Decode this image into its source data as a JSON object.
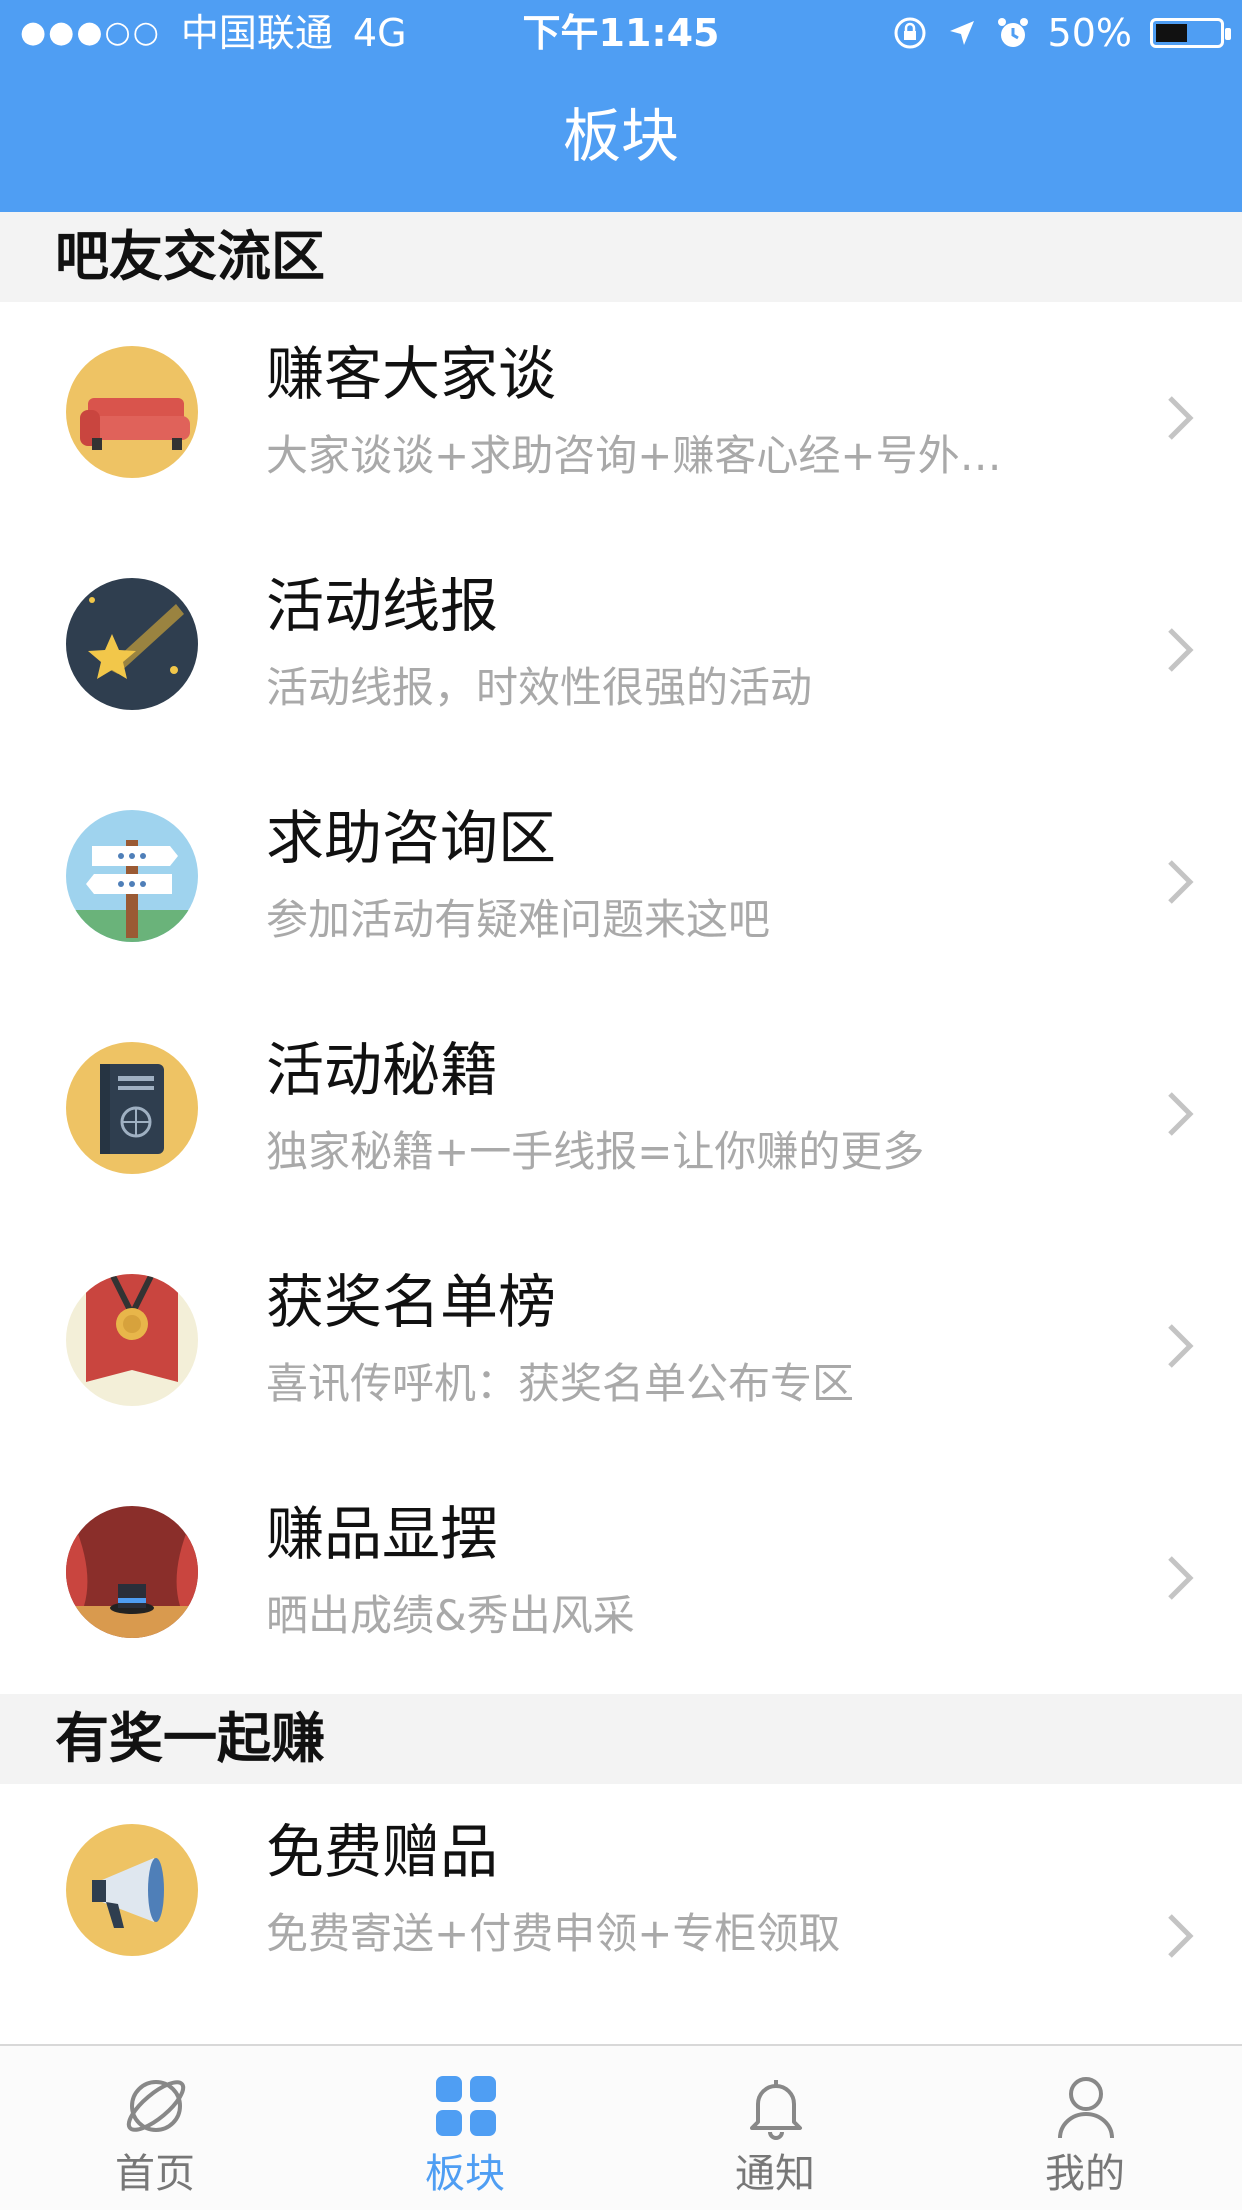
{
  "status_bar": {
    "signal_dots": "●●●○○",
    "carrier": "中国联通",
    "network": "4G",
    "time": "下午11:45",
    "battery_percent": "50%",
    "battery_level": 0.5
  },
  "header": {
    "title": "板块"
  },
  "sections": [
    {
      "title": "吧友交流区",
      "items": [
        {
          "name": "赚客大家谈",
          "desc": "大家谈谈+求助咨询+赚客心经+号外…",
          "icon": "sofa-icon"
        },
        {
          "name": "活动线报",
          "desc": "活动线报，时效性很强的活动",
          "icon": "shooting-star-icon"
        },
        {
          "name": "求助咨询区",
          "desc": "参加活动有疑难问题来这吧",
          "icon": "signpost-icon"
        },
        {
          "name": "活动秘籍",
          "desc": "独家秘籍+一手线报=让你赚的更多",
          "icon": "passport-book-icon"
        },
        {
          "name": "获奖名单榜",
          "desc": "喜讯传呼机：获奖名单公布专区",
          "icon": "medal-icon"
        },
        {
          "name": "赚品显摆",
          "desc": " 晒出成绩&秀出风采",
          "icon": "stage-hat-icon"
        }
      ]
    },
    {
      "title": "有奖一起赚",
      "items": [
        {
          "name": "免费赠品",
          "desc": "免费寄送+付费申领+专柜领取",
          "icon": "megaphone-icon"
        }
      ]
    }
  ],
  "tabbar": {
    "items": [
      {
        "label": "首页",
        "icon": "planet-icon",
        "active": false
      },
      {
        "label": "板块",
        "icon": "grid-icon",
        "active": true
      },
      {
        "label": "通知",
        "icon": "bell-icon",
        "active": false
      },
      {
        "label": "我的",
        "icon": "person-icon",
        "active": false
      }
    ]
  },
  "colors": {
    "accent": "#4f9ef3",
    "section_bg": "#f3f3f3",
    "desc_text": "#a9a9a9"
  }
}
